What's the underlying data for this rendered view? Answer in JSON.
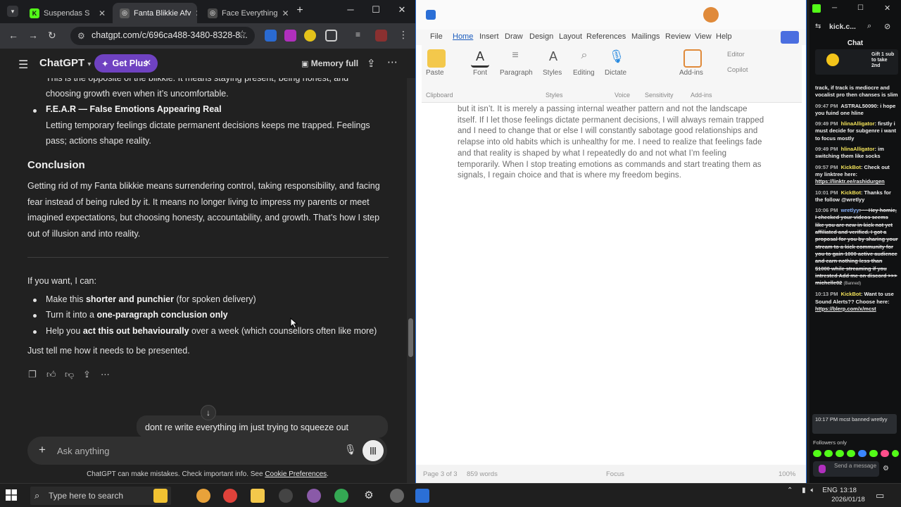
{
  "browser": {
    "tabs": [
      {
        "title": "Suspendas S",
        "icon": "kick-icon",
        "color": "#53fc18",
        "active": false
      },
      {
        "title": "Fanta Blikkie Afv",
        "icon": "chatgpt-icon",
        "color": "#9a9a9a",
        "active": true
      },
      {
        "title": "Face Everything",
        "icon": "chatgpt-icon",
        "color": "#9a9a9a",
        "active": false
      }
    ],
    "new_tab": "+",
    "url": "chatgpt.com/c/696ca488-3480-8328-8..."
  },
  "chatgpt": {
    "title": "ChatGPT",
    "get_plus": "Get Plus",
    "memory": "Memory full",
    "messages": {
      "cut_top": "This is the opposite of the blikkie. It means staying present, being honest, and",
      "line2": "choosing growth even when it’s uncomfortable.",
      "fear_title": "F.E.A.R — False Emotions Appearing Real",
      "fear_body_1": "Letting temporary feelings dictate permanent decisions keeps me trapped. Feelings",
      "fear_body_2": "pass; actions shape reality.",
      "conclusion_title": "Conclusion",
      "conclusion_body": "Getting rid of my Fanta blikkie means surrendering control, taking responsibility, and facing fear instead of being ruled by it. It means no longer living to impress my parents or meet imagined expectations, but choosing honesty, accountability, and growth. That’s how I step out of illusion and into reality.",
      "offer": "If you want, I can:",
      "opt1_pre": "Make this ",
      "opt1_bold": "shorter and punchier",
      "opt1_post": " (for spoken delivery)",
      "opt2_pre": "Turn it into a ",
      "opt2_bold": "one-paragraph conclusion only",
      "opt3_pre": "Help you ",
      "opt3_bold": "act this out behaviourally",
      "opt3_post": " over a week (which counsellors often like more)",
      "closing": "Just tell me how it needs to be presented."
    },
    "user_message": "dont re write everything im just trying to squeeze out",
    "composer_placeholder": "Ask anything",
    "disclaimer": "ChatGPT can make mistakes. Check important info. See ",
    "disclaimer_link": "Cookie Preferences",
    "disclaimer_end": "."
  },
  "word": {
    "menu": [
      "File",
      "Home",
      "Insert",
      "Draw",
      "Design",
      "Layout",
      "References",
      "Mailings",
      "Review",
      "View",
      "Help"
    ],
    "ribbon": [
      "Paste",
      "Font",
      "Paragraph",
      "Styles",
      "Editing",
      "Dictate",
      "Add-ins",
      "Editor",
      "Copilot"
    ],
    "ribbon_groups": [
      "Clipboard",
      "Styles",
      "Voice",
      "Sensitivity",
      "Add-ins"
    ],
    "doc_text": "but it isn’t. It is merely a passing internal weather pattern and not the landscape itself. If I let those feelings dictate permanent decisions, I will always remain trapped and I need to change that or else I will constantly sabotage good relationships and relapse into old habits which is unhealthy for me. I need to realize that feelings fade and that reality is shaped by what I repeatedly do and not what I’m feeling temporarily. When I stop treating emotions as commands and start treating them as signals, I regain choice and that is where my freedom begins.",
    "status_page": "Page 3 of 3",
    "status_words": "859 words",
    "status_focus": "Focus",
    "status_zoom": "100%"
  },
  "kick": {
    "title": "kick.c...",
    "chat_label": "Chat",
    "gift_text": "Gift 1 sub to take 2nd",
    "messages": [
      {
        "time": "",
        "user": "",
        "text": "track, if track is mediocre and vocalist pro then chanses is slim",
        "type": "plain"
      },
      {
        "time": "09:47 PM",
        "user": "",
        "text": "ASTRAL50090: i hope you fuind one hline",
        "type": "plain"
      },
      {
        "time": "09:49 PM",
        "user": "hlinaAlligator",
        "text": ": firstly i must decide for subgenre i want to focus mostly",
        "type": "user"
      },
      {
        "time": "09:49 PM",
        "user": "hlinaAlligator",
        "text": ": im switching them like socks",
        "type": "user"
      },
      {
        "time": "09:57 PM",
        "user": "KickBot",
        "text": ": Check out my linktree here: ",
        "link": "https://linktr.ee/rashidurgen",
        "type": "bot"
      },
      {
        "time": "10:01 PM",
        "user": "KickBot",
        "text": ": Thanks for the follow @wretlyy",
        "type": "bot"
      },
      {
        "time": "10:06 PM",
        "user": "wretlyy",
        "text": ": ~~Hey homie, I checked your videos seems like you are new in kick not yet affiliated and verified. I got a proposal for you by sharing your stream to a kick community for you to gain 1000 active audience and earn nothing less than $1000 while streaming if you intrested Add me on discord >>> michelle02",
        "banned": "(Banned)",
        "type": "spam"
      },
      {
        "time": "10:13 PM",
        "user": "KickBot",
        "text": ": Want to use Sound Alerts?? Choose here: ",
        "link": "https://blerp.com/x/mcst",
        "type": "bot"
      }
    ],
    "pinned": "10:17 PM  mcst banned wretlyy",
    "followers_only": "Followers only",
    "send_placeholder": "Send a message"
  },
  "taskbar": {
    "search_placeholder": "Type here to search",
    "lang": "ENG",
    "time": "13:18",
    "date": "2026/01/18"
  }
}
